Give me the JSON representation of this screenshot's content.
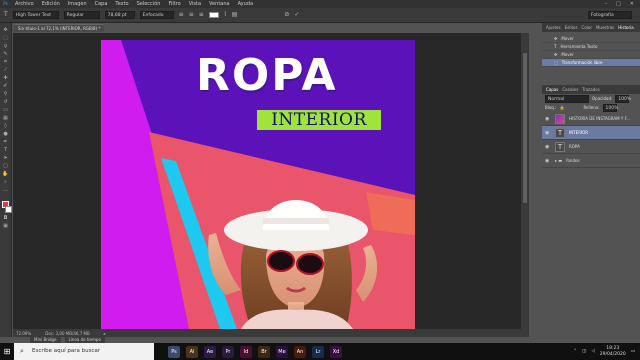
{
  "app": {
    "logo": "Ps"
  },
  "menubar": {
    "items": [
      "Archivo",
      "Edición",
      "Imagen",
      "Capa",
      "Texto",
      "Selección",
      "Filtro",
      "Vista",
      "Ventana",
      "Ayuda"
    ],
    "window_controls": [
      "–",
      "□",
      "✕"
    ]
  },
  "options_bar": {
    "tool_icon": "T",
    "font_family": "High Tower Text",
    "font_style": "Regular",
    "font_size": "78,68 pt",
    "antialias": "Enfocado",
    "search_placeholder": "Fotografía"
  },
  "document": {
    "tab_title": "Sin título-1 al 72,1% (INTERIOR, RGB/8) *"
  },
  "artwork": {
    "headline": "ROPA",
    "subhead": "INTERIOR",
    "colors": {
      "purple": "#5b12b8",
      "magenta": "#d11cf0",
      "coral": "#e9556a",
      "cyan": "#1ec8ef",
      "green": "#9fe33c"
    }
  },
  "statusbar": {
    "zoom": "72,09%",
    "doc_size": "Doc: 3,00 MB/46,7 MB",
    "arrow": "▸"
  },
  "bottom_tabs": [
    "Mini Bridge",
    "Línea de tiempo"
  ],
  "history_panel": {
    "tabs": [
      "Ajustes",
      "Estilos",
      "Color",
      "Muestras",
      "Historia"
    ],
    "active_tab": "Historia",
    "items": [
      "Mover",
      "Herramienta Texto",
      "Mover",
      "Transformación libre"
    ]
  },
  "layers_panel": {
    "tabs": [
      "Capas",
      "Canales",
      "Trazados"
    ],
    "blend_mode": "Normal",
    "opacity_label": "Opacidad:",
    "opacity_value": "100%",
    "lock_label": "Bloq.:",
    "fill_label": "Relleno:",
    "fill_value": "100%",
    "layers": [
      {
        "name": "HISTORIA DE INSTAGRAM Y F...",
        "type": "image"
      },
      {
        "name": "INTERIOR",
        "type": "text",
        "selected": true
      },
      {
        "name": "ROPA",
        "type": "text"
      },
      {
        "name": "fondos",
        "type": "group"
      }
    ]
  },
  "taskbar": {
    "search_placeholder": "Escribe aquí para buscar",
    "time": "18:23",
    "date": "29/04/2020",
    "apps": [
      "Ps",
      "Ai",
      "Ae",
      "Pr",
      "Id",
      "Br",
      "Me",
      "An",
      "Lr",
      "Xd"
    ]
  }
}
